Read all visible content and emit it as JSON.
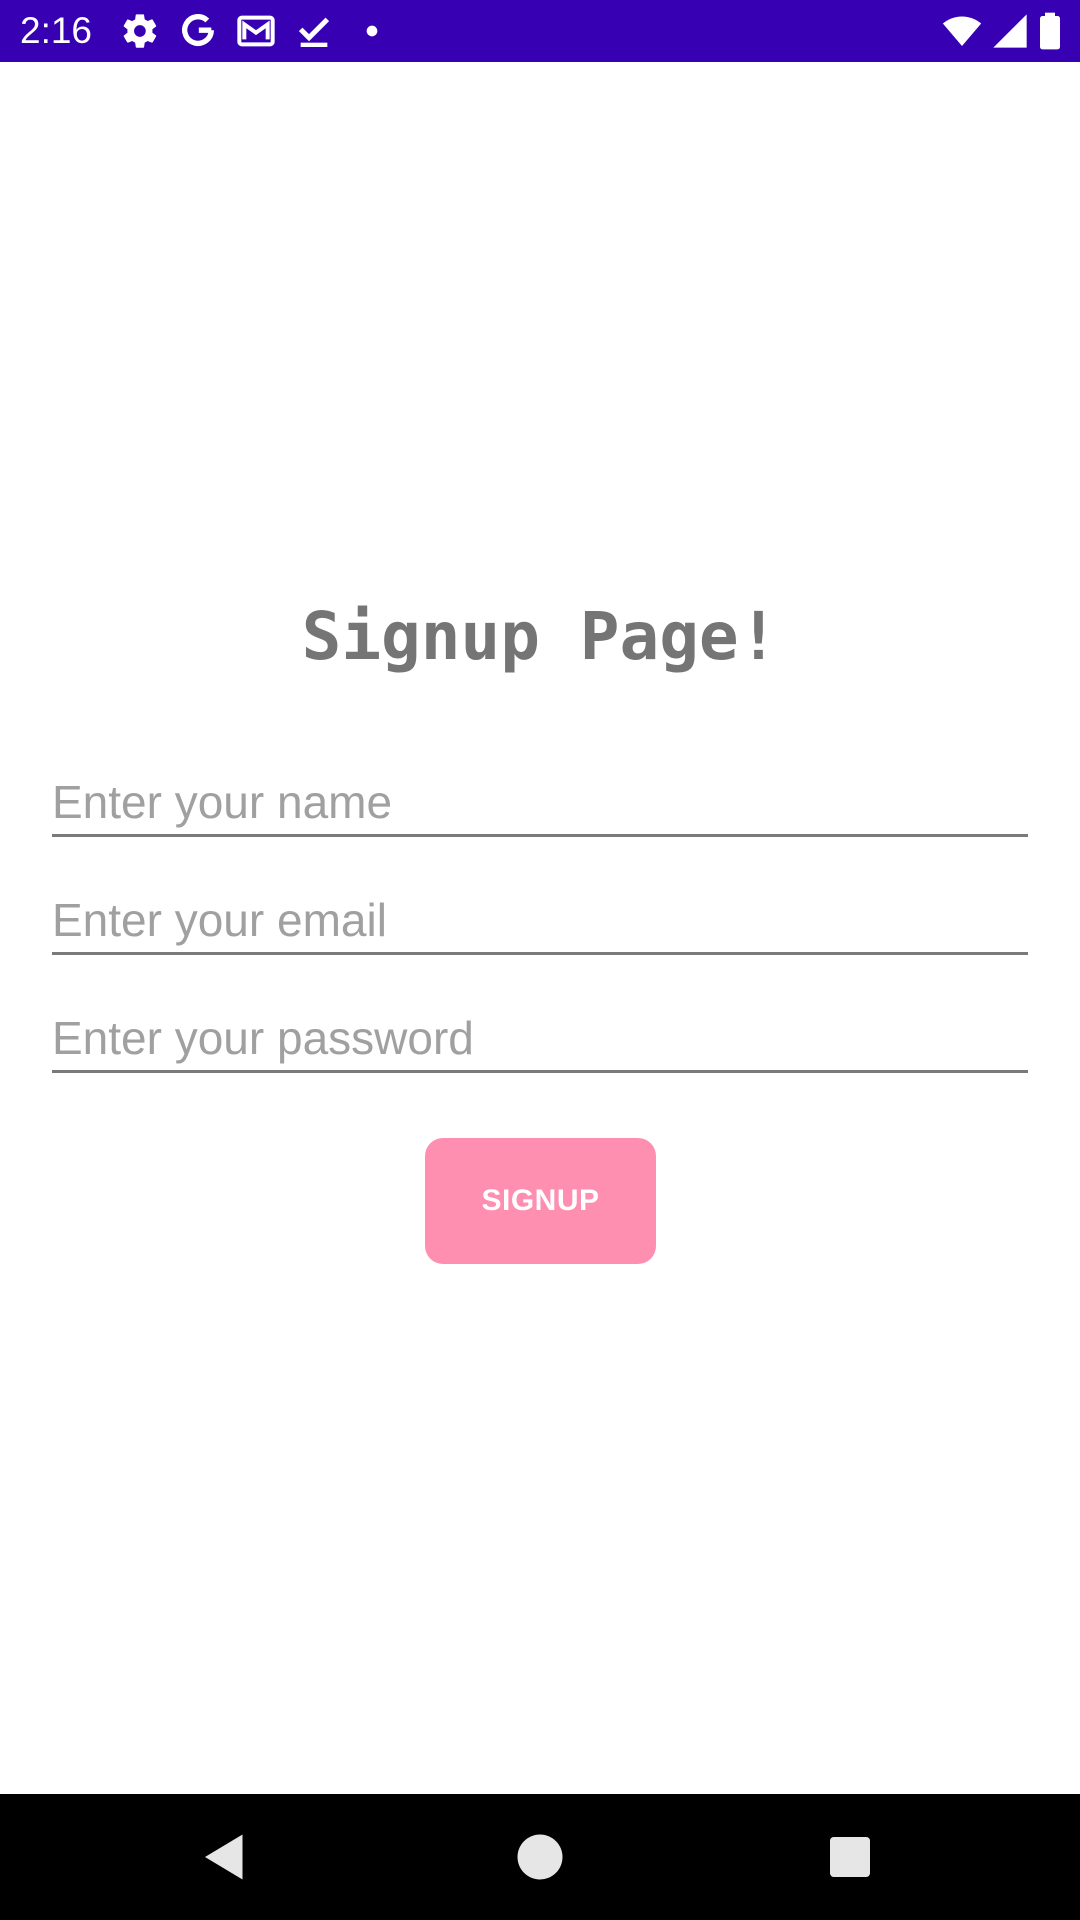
{
  "status_bar": {
    "time": "2:16",
    "background": "#3700b3",
    "left_icons": [
      "gear-icon",
      "google-g-icon",
      "gmail-icon",
      "download-done-icon",
      "dot-icon"
    ],
    "right_icons": [
      "wifi-icon",
      "cell-signal-icon",
      "battery-icon"
    ]
  },
  "main": {
    "title": "Signup Page!",
    "name_field": {
      "placeholder": "Enter your name",
      "value": ""
    },
    "email_field": {
      "placeholder": "Enter your email",
      "value": ""
    },
    "password_field": {
      "placeholder": "Enter your password",
      "value": ""
    },
    "signup_button_label": "SIGNUP",
    "accent_color": "#ff8fb1"
  },
  "nav_bar": {
    "buttons": [
      "back-icon",
      "home-icon",
      "recents-icon"
    ]
  }
}
